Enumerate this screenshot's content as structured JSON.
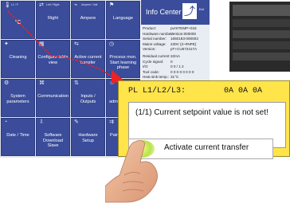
{
  "tiles": [
    {
      "label": "°C",
      "mini": "L1 / P",
      "icon": "thermometer-icon",
      "big": true
    },
    {
      "label": "Right",
      "mini": "Left / Right",
      "icon": "arrows-icon"
    },
    {
      "label": "Ampere",
      "mini": "Ampere / Volt",
      "icon": "meter-icon"
    },
    {
      "label": "Language",
      "mini": "",
      "icon": "flag-icon"
    },
    {
      "label": "Cleaning",
      "mini": "",
      "icon": "broom-icon"
    },
    {
      "label": "Configure table view",
      "mini": "",
      "icon": "table-icon"
    },
    {
      "label": "Active current transfer",
      "mini": "",
      "icon": "transfer-icon"
    },
    {
      "label": "Process mon. Start learning phase",
      "mini": "",
      "icon": "process-icon"
    },
    {
      "label": "System parameters",
      "mini": "",
      "icon": "gear-icon"
    },
    {
      "label": "Communication",
      "mini": "",
      "icon": "network-icon"
    },
    {
      "label": "Inputs / Outputs",
      "mini": "",
      "icon": "io-icon"
    },
    {
      "label": "User administration",
      "mini": "",
      "icon": "user-icon"
    },
    {
      "label": "Date / Time",
      "mini": "",
      "icon": "clock-icon"
    },
    {
      "label": "Software Download Slave",
      "mini": "",
      "icon": "download-icon"
    },
    {
      "label": "Hardware Setup",
      "mini": "",
      "icon": "wrench-icon"
    },
    {
      "label": "Pairing Mode",
      "mini": "",
      "icon": "pairing-icon"
    }
  ],
  "info_center": {
    "title": "Info Center",
    "exit_label": "Exit",
    "rows_top": [
      {
        "k": "Product:",
        "v": "pvrSTEMP+018"
      },
      {
        "k": "Hardware number:",
        "v": "Version:000000"
      },
      {
        "k": "Serial number:",
        "v": "1650183-000003"
      },
      {
        "k": "Mains voltage:",
        "v": "230V (3~#NPE)"
      },
      {
        "k": "Version:",
        "v": "pT+CU672417A"
      }
    ],
    "rows_bottom": [
      {
        "k": "Residual current:",
        "v": "10mA"
      },
      {
        "k": "Cycle signal:",
        "v": "0"
      },
      {
        "k": "I/O:",
        "v": "0 0 / 1 2"
      },
      {
        "k": "Tool code:",
        "v": "0 0 0 0 0 0 0 0"
      },
      {
        "k": "Heat sink temp.:",
        "v": "31°C"
      }
    ]
  },
  "popup": {
    "header_left": "PL L1/L2/L3:",
    "header_right": "0A  0A  0A",
    "message": "(1/1) Current setpoint value is not set!",
    "button_label": "Activate current transfer"
  },
  "colors": {
    "tile": "#3a4c9a",
    "popup": "#ffe44a",
    "connector": "#e22222"
  }
}
